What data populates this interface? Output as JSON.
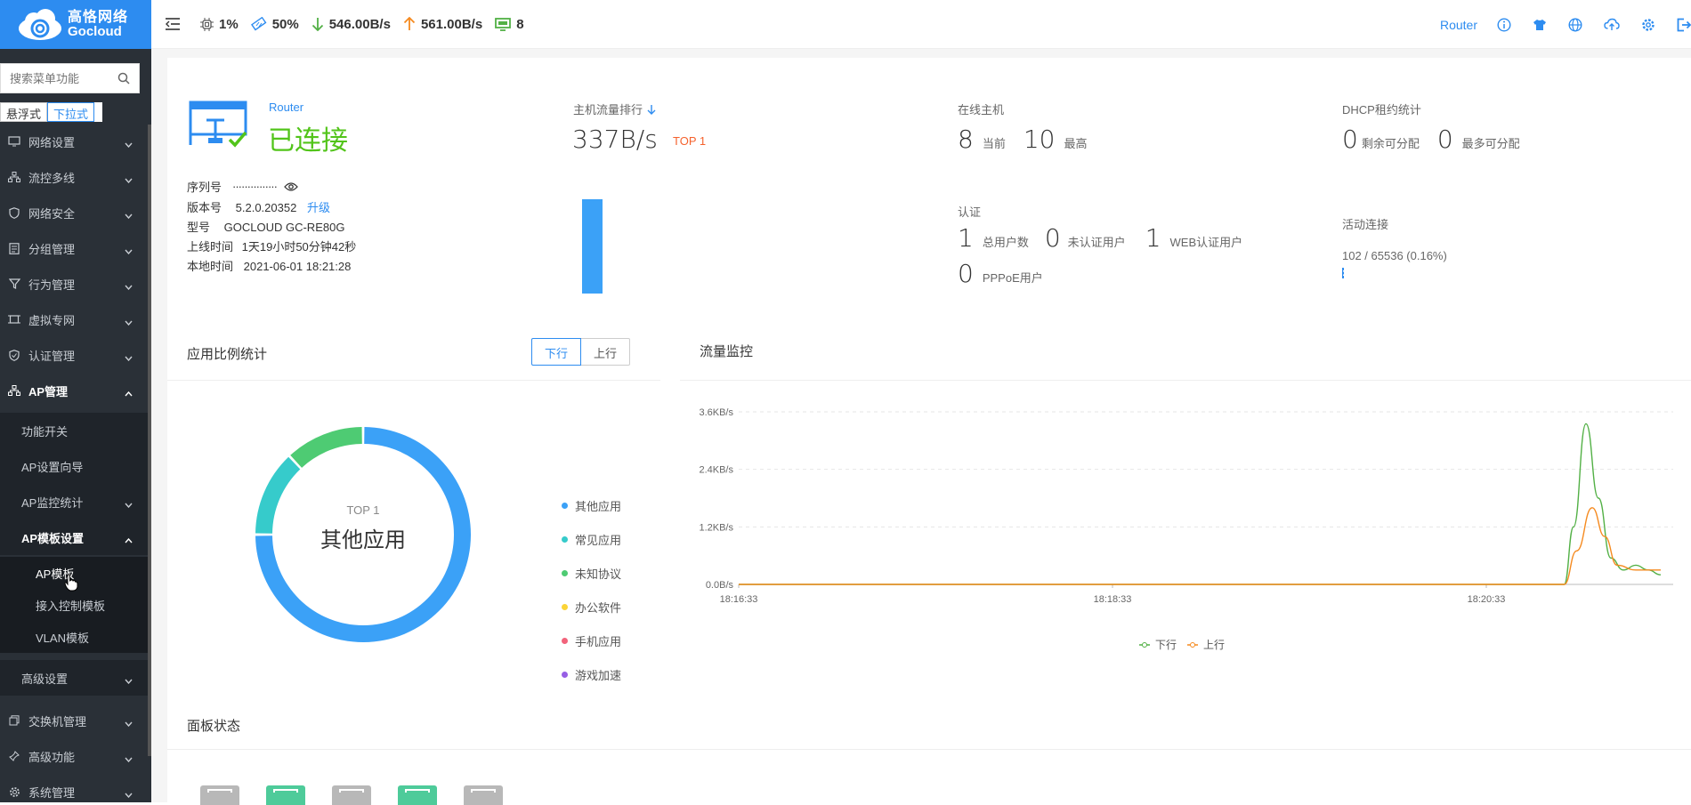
{
  "brand": {
    "cn": "高恪网络",
    "en": "Gocloud"
  },
  "sidebar": {
    "search_placeholder": "搜索菜单功能",
    "mode_float": "悬浮式",
    "mode_dropdown": "下拉式",
    "items": [
      {
        "label": "网络设置",
        "icon": "monitor-icon"
      },
      {
        "label": "流控多线",
        "icon": "network-icon"
      },
      {
        "label": "网络安全",
        "icon": "shield-icon"
      },
      {
        "label": "分组管理",
        "icon": "list-icon"
      },
      {
        "label": "行为管理",
        "icon": "filter-icon"
      },
      {
        "label": "虚拟专网",
        "icon": "vpn-icon"
      },
      {
        "label": "认证管理",
        "icon": "verified-icon"
      },
      {
        "label": "AP管理",
        "icon": "ap-icon"
      }
    ],
    "ap_sub": {
      "switch": "功能开关",
      "wizard": "AP设置向导",
      "monitor": "AP监控统计",
      "template_settings": "AP模板设置",
      "template": "AP模板",
      "access_template": "接入控制模板",
      "vlan_template": "VLAN模板",
      "advanced": "高级设置"
    },
    "bottom_items": [
      {
        "label": "交换机管理",
        "icon": "switch-icon"
      },
      {
        "label": "高级功能",
        "icon": "pin-icon"
      },
      {
        "label": "系统管理",
        "icon": "gear-icon"
      }
    ]
  },
  "topbar": {
    "cpu": "1%",
    "mem": "50%",
    "down": "546.00B/s",
    "up": "561.00B/s",
    "hosts": "8",
    "router": "Router"
  },
  "status": {
    "router_label": "Router",
    "connected": "已连接",
    "serial_label": "序列号",
    "serial_value": "···············",
    "version_label": "版本号",
    "version_value": "5.2.0.20352",
    "upgrade": "升级",
    "model_label": "型号",
    "model_value": "GOCLOUD GC-RE80G",
    "uptime_label": "上线时间",
    "uptime_value": "1天19小时50分钟42秒",
    "localtime_label": "本地时间",
    "localtime_value": "2021-06-01 18:21:28"
  },
  "traffic_rank": {
    "title": "主机流量排行",
    "value": "337B/s",
    "top": "TOP 1",
    "bar_fraction": 1.0
  },
  "online_hosts": {
    "title": "在线主机",
    "current": "8",
    "current_label": "当前",
    "max": "10",
    "max_label": "最高"
  },
  "dhcp": {
    "title": "DHCP租约统计",
    "remaining": "0",
    "remaining_label": "剩余可分配",
    "max": "0",
    "max_label": "最多可分配"
  },
  "auth": {
    "title": "认证",
    "total": "1",
    "total_label": "总用户数",
    "unauth": "0",
    "unauth_label": "未认证用户",
    "web": "1",
    "web_label": "WEB认证用户",
    "pppoe": "0",
    "pppoe_label": "PPPoE用户"
  },
  "active_conn": {
    "title": "活动连接",
    "value": "102 / 65536 (0.16%)",
    "fraction": 0.0016
  },
  "app_ratio": {
    "title": "应用比例统计",
    "tab_down": "下行",
    "tab_up": "上行",
    "center_top": "TOP 1",
    "center_name": "其他应用",
    "legend": [
      {
        "name": "其他应用",
        "color": "#3ba1f7"
      },
      {
        "name": "常见应用",
        "color": "#36cbcb"
      },
      {
        "name": "未知协议",
        "color": "#4ecb73"
      },
      {
        "name": "办公软件",
        "color": "#fbd437"
      },
      {
        "name": "手机应用",
        "color": "#f2637b"
      },
      {
        "name": "游戏加速",
        "color": "#975fe5"
      }
    ]
  },
  "traffic_monitor": {
    "title": "流量监控",
    "legend_down": "下行",
    "legend_up": "上行"
  },
  "chart_data": {
    "type": "line",
    "title": "",
    "y_ticks": [
      "0.0B/s",
      "1.2KB/s",
      "2.4KB/s",
      "3.6KB/s"
    ],
    "ylim": [
      0,
      3600
    ],
    "x_ticks": [
      "18:16:33",
      "18:18:33",
      "18:20:33"
    ],
    "x_range_seconds": [
      0,
      300
    ],
    "series": [
      {
        "name": "下行",
        "color": "#52b045",
        "points": [
          [
            0,
            0
          ],
          [
            265,
            0
          ],
          [
            268,
            1200
          ],
          [
            272,
            3350
          ],
          [
            276,
            1800
          ],
          [
            280,
            550
          ],
          [
            284,
            300
          ],
          [
            288,
            400
          ],
          [
            292,
            300
          ],
          [
            296,
            200
          ]
        ]
      },
      {
        "name": "上行",
        "color": "#f58a1f",
        "points": [
          [
            0,
            0
          ],
          [
            265,
            0
          ],
          [
            269,
            700
          ],
          [
            274,
            1600
          ],
          [
            278,
            1000
          ],
          [
            282,
            400
          ],
          [
            288,
            300
          ],
          [
            296,
            300
          ]
        ]
      }
    ],
    "pie": {
      "slices": [
        {
          "name": "其他应用",
          "value": 75,
          "color": "#3ba1f7"
        },
        {
          "name": "常见应用",
          "value": 13,
          "color": "#36cbcb"
        },
        {
          "name": "未知协议",
          "value": 12,
          "color": "#4ecb73"
        }
      ]
    }
  },
  "panel_status": {
    "title": "面板状态",
    "ports": [
      {
        "color": "#b8b8b8"
      },
      {
        "color": "#4ecb9a"
      },
      {
        "color": "#b8b8b8"
      },
      {
        "color": "#4ecb9a"
      },
      {
        "color": "#b8b8b8"
      }
    ]
  }
}
